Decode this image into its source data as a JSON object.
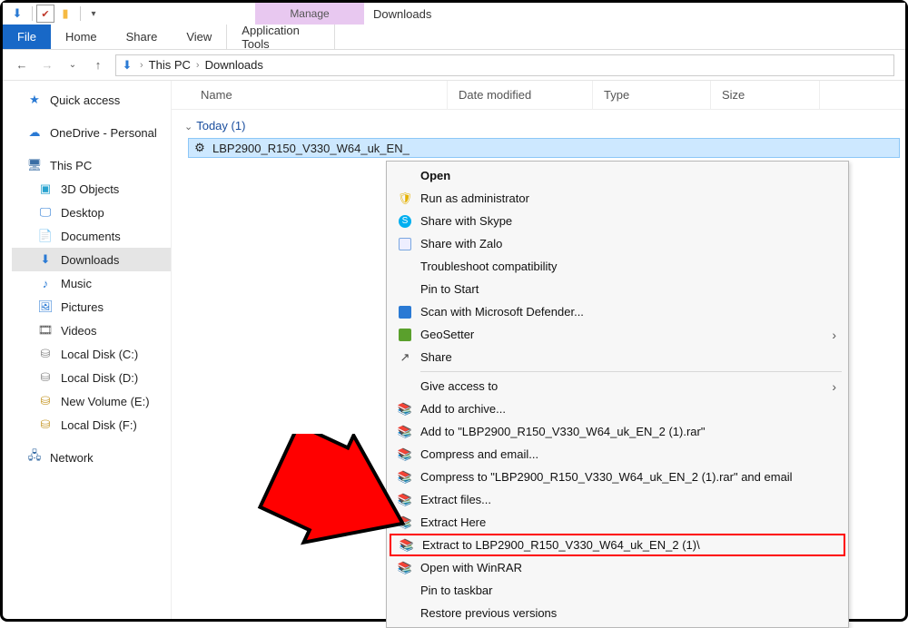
{
  "quick_access": {
    "manage_label": "Manage",
    "caption": "Downloads"
  },
  "ribbon": {
    "file": "File",
    "home": "Home",
    "share": "Share",
    "view": "View",
    "tools": "Application Tools"
  },
  "breadcrumb": {
    "root": "This PC",
    "leaf": "Downloads"
  },
  "sidebar": {
    "quick": "Quick access",
    "onedrive": "OneDrive - Personal",
    "thispc": "This PC",
    "objects3d": "3D Objects",
    "desktop": "Desktop",
    "documents": "Documents",
    "downloads": "Downloads",
    "music": "Music",
    "pictures": "Pictures",
    "videos": "Videos",
    "diskc": "Local Disk (C:)",
    "diskd": "Local Disk (D:)",
    "diske": "New Volume (E:)",
    "diskf": "Local Disk (F:)",
    "network": "Network"
  },
  "columns": {
    "name": "Name",
    "modified": "Date modified",
    "type": "Type",
    "size": "Size"
  },
  "group_label": "Today (1)",
  "file_name": "LBP2900_R150_V330_W64_uk_EN_",
  "context_menu": {
    "open": "Open",
    "runadmin": "Run as administrator",
    "skype": "Share with Skype",
    "zalo": "Share with Zalo",
    "troubleshoot": "Troubleshoot compatibility",
    "pinstart": "Pin to Start",
    "defender": "Scan with Microsoft Defender...",
    "geosetter": "GeoSetter",
    "share": "Share",
    "giveaccess": "Give access to",
    "addarchive": "Add to archive...",
    "addrar": "Add to \"LBP2900_R150_V330_W64_uk_EN_2 (1).rar\"",
    "compemail": "Compress and email...",
    "compemailto": "Compress to \"LBP2900_R150_V330_W64_uk_EN_2 (1).rar\" and email",
    "extractfiles": "Extract files...",
    "extracthere": "Extract Here",
    "extractto": "Extract to LBP2900_R150_V330_W64_uk_EN_2 (1)\\",
    "openrar": "Open with WinRAR",
    "pintask": "Pin to taskbar",
    "restore": "Restore previous versions"
  }
}
